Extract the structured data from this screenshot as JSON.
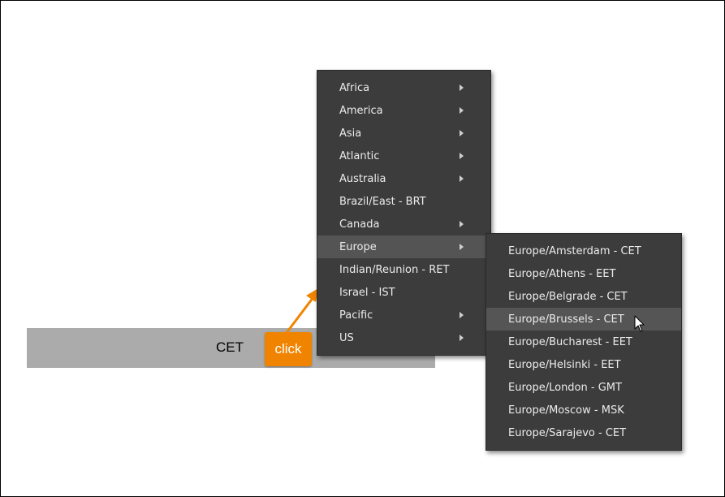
{
  "timezone_bar": {
    "value": "CET"
  },
  "annotation": {
    "click_label": "click",
    "accent_color": "#f08400"
  },
  "menu": {
    "items": [
      {
        "label": "Africa",
        "has_submenu": true
      },
      {
        "label": "America",
        "has_submenu": true
      },
      {
        "label": "Asia",
        "has_submenu": true
      },
      {
        "label": "Atlantic",
        "has_submenu": true
      },
      {
        "label": "Australia",
        "has_submenu": true
      },
      {
        "label": "Brazil/East - BRT",
        "has_submenu": false
      },
      {
        "label": "Canada",
        "has_submenu": true
      },
      {
        "label": "Europe",
        "has_submenu": true,
        "active": true
      },
      {
        "label": "Indian/Reunion - RET",
        "has_submenu": false
      },
      {
        "label": "Israel - IST",
        "has_submenu": false
      },
      {
        "label": "Pacific",
        "has_submenu": true
      },
      {
        "label": "US",
        "has_submenu": true
      }
    ]
  },
  "submenu": {
    "items": [
      {
        "label": "Europe/Amsterdam - CET"
      },
      {
        "label": "Europe/Athens - EET"
      },
      {
        "label": "Europe/Belgrade - CET"
      },
      {
        "label": "Europe/Brussels - CET",
        "hovered": true
      },
      {
        "label": "Europe/Bucharest - EET"
      },
      {
        "label": "Europe/Helsinki - EET"
      },
      {
        "label": "Europe/London - GMT"
      },
      {
        "label": "Europe/Moscow - MSK"
      },
      {
        "label": "Europe/Sarajevo - CET"
      }
    ]
  },
  "icons": {
    "arrow": "annotation-arrow-icon",
    "cursor": "mouse-pointer-icon",
    "submenu_indicator": "chevron-right-icon"
  },
  "colors": {
    "menu_bg": "#3c3c3c",
    "menu_active": "#545454",
    "bar_bg": "#ababab"
  }
}
